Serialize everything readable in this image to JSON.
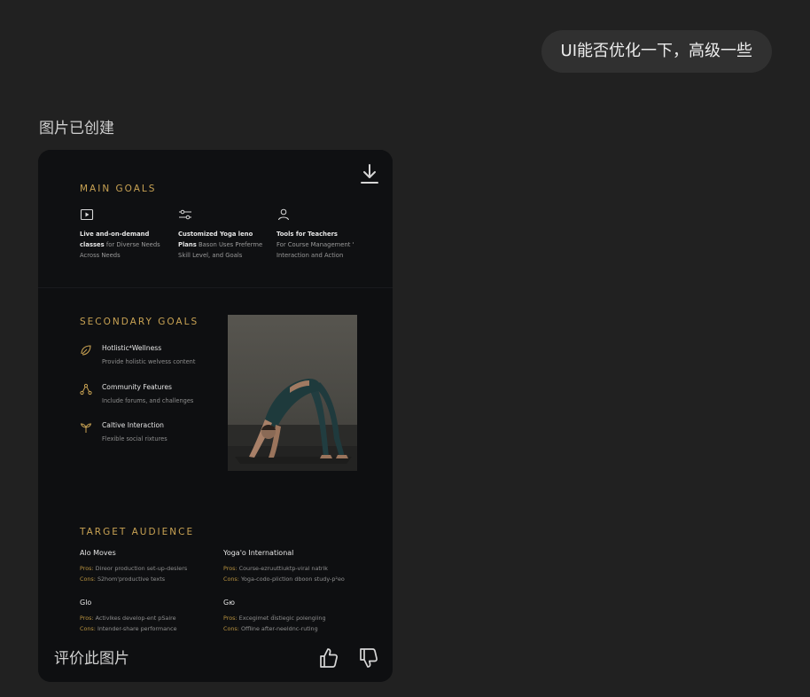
{
  "chat": {
    "user_message": "UI能否优化一下，高级一些",
    "status_label": "图片已创建"
  },
  "card": {
    "main_goals": {
      "title": "MAIN GOALS",
      "items": [
        {
          "icon": "play-icon",
          "bold_a": "Live and-on-demand",
          "bold_b": "classes",
          "rest_b": " for Diverse Needs",
          "line_c": "Across Needs"
        },
        {
          "icon": "sliders-icon",
          "bold_a": "Customized Yoga leno",
          "bold_b": "Plans",
          "rest_b": " Bason Uses Preferme",
          "line_c": "Skill Level, and Goals"
        },
        {
          "icon": "user-icon",
          "bold_a": "Tools for Teachers",
          "bold_b": "",
          "rest_b": "For Course Management '",
          "line_c": "Interaction and Action"
        }
      ]
    },
    "secondary_goals": {
      "title": "SECONDARY GOALS",
      "items": [
        {
          "icon": "leaf-icon",
          "title": "Hotlistic⁴Wellness",
          "desc": "Provide holistic welvess content"
        },
        {
          "icon": "community-icon",
          "title": "Community Features",
          "desc": "Include forums, and challenges"
        },
        {
          "icon": "sprout-icon",
          "title": "Caltive Interaction",
          "desc": "Flexible social rixtures"
        }
      ]
    },
    "target_audience": {
      "title": "TARGET AUDIENCE",
      "pros_label": "Pros:",
      "cons_label": "Cons:",
      "items": [
        {
          "name": "Alo Moves",
          "pros": " Direor production set-up-deslers",
          "cons": " S2hom'productive texts"
        },
        {
          "name": "Yoga'o International",
          "pros": " Course-ezruuttiuktp-viral natrik",
          "cons": " Yoga-codo-pliction dboon study-p²eo"
        },
        {
          "name": "Glo",
          "pros": " Activlkes develop-ent pSaire",
          "cons": " Intender-share performance"
        },
        {
          "name": "Gю",
          "pros": " Excegimet d̈istiegic polengiing",
          "cons": " Offline after-neeldnc-ruting"
        }
      ]
    }
  },
  "rating": {
    "label": "评价此图片"
  },
  "colors": {
    "background": "#212121",
    "bubble": "#303030",
    "card": "#0e0f11",
    "gold_accent": "#c8a253"
  }
}
